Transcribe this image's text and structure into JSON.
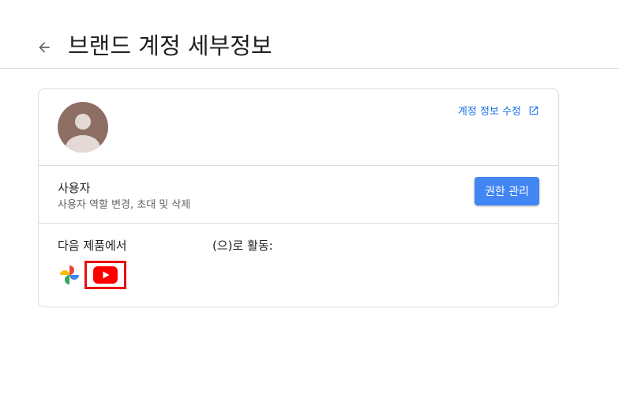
{
  "header": {
    "title": "브랜드 계정 세부정보",
    "back_icon": "arrow-back-icon"
  },
  "profile": {
    "avatar_icon": "default-avatar-icon",
    "edit_link_label": "계정 정보 수정",
    "edit_link_icon": "open-in-new-icon",
    "avatar_color": "#8d6e63"
  },
  "users": {
    "title": "사용자",
    "description": "사용자 역할 변경, 초대 및 삭제",
    "manage_button_label": "권한 관리",
    "button_color": "#4285f4"
  },
  "products": {
    "label_part1": "다음 제품에서",
    "label_part2": "(으)로 활동:",
    "items": [
      {
        "name": "Google Photos",
        "icon": "google-photos-icon"
      },
      {
        "name": "YouTube",
        "icon": "youtube-icon",
        "highlighted": true,
        "highlight_color": "#e8100c"
      }
    ]
  },
  "colors": {
    "link": "#1a73e8",
    "border": "#dadce0",
    "text_primary": "#202124",
    "text_secondary": "#5f6368"
  }
}
